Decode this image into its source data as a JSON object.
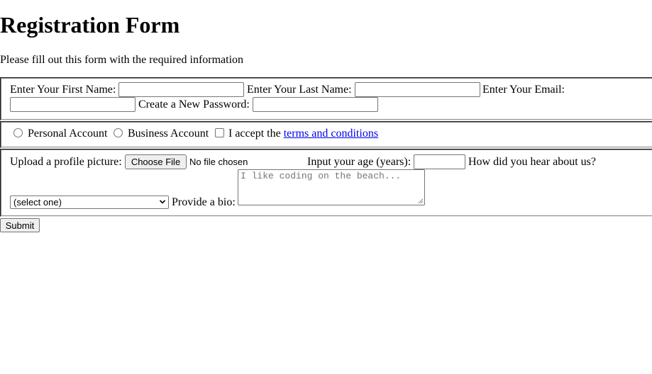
{
  "page": {
    "title": "Registration Form",
    "subtitle": "Please fill out this form with the required information"
  },
  "names_section": {
    "first_name_label": "Enter Your First Name:",
    "last_name_label": "Enter Your Last Name:",
    "email_label": "Enter Your Email:",
    "password_label": "Create a New Password:",
    "first_name_value": "",
    "last_name_value": "",
    "email_value": "",
    "password_value": ""
  },
  "account_section": {
    "personal_label": "Personal Account",
    "business_label": "Business Account",
    "accept_prefix": "I accept the",
    "terms_link": "terms and conditions"
  },
  "profile_section": {
    "picture_label": "Upload a profile picture:",
    "choose_file_button": "Choose File",
    "no_file_text": "No file chosen",
    "age_label": "Input your age (years):",
    "age_value": "",
    "referrer_label": "How did you hear about us?",
    "referrer_selected": "(select one)",
    "bio_label": "Provide a bio:",
    "bio_placeholder": "I like coding on the beach..."
  },
  "submit_button": "Submit",
  "icons": {
    "select_arrow": "chevron-down-icon",
    "resize_handle": "resize-grip-icon"
  },
  "colors": {
    "link": "#0000ee",
    "button_bg": "#efefef",
    "border": "#767676"
  }
}
